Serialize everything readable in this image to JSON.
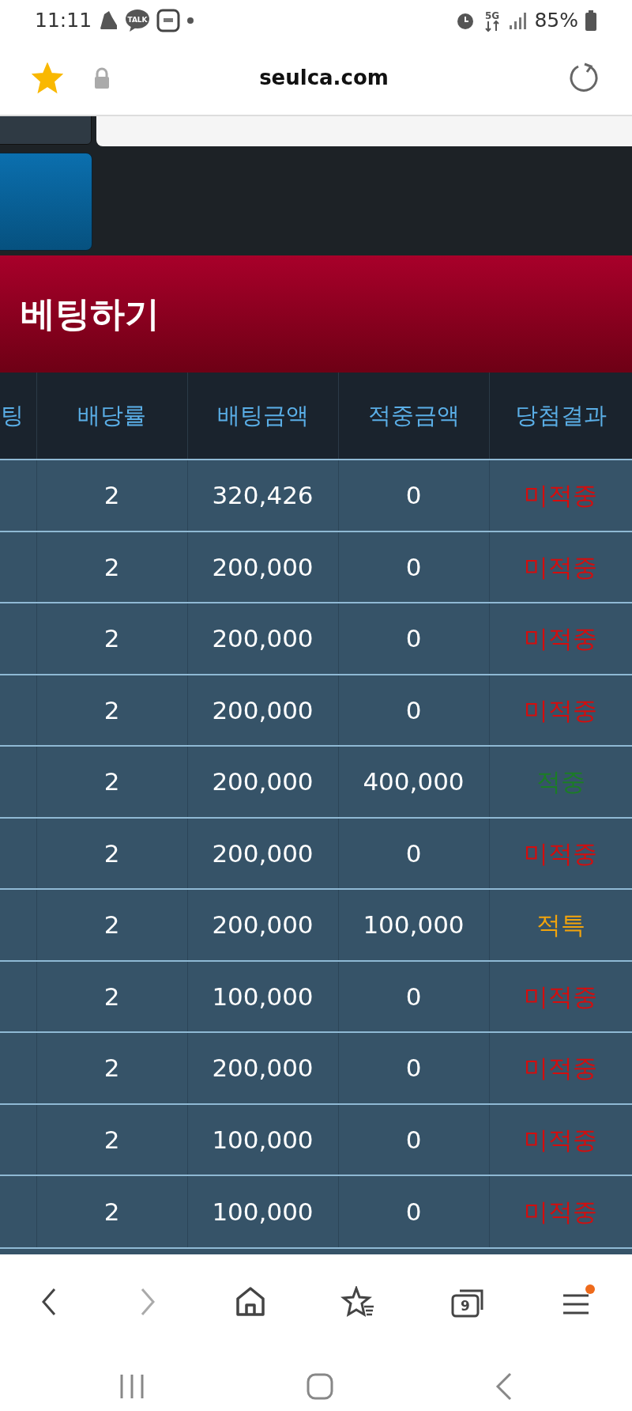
{
  "status_bar": {
    "time": "11:11",
    "chat_badge": "TALK",
    "network": "5G",
    "battery": "85%"
  },
  "address_bar": {
    "url": "seulca.com",
    "bookmarked": true
  },
  "section_title": "베팅하기",
  "table": {
    "columns": [
      "팅",
      "배당률",
      "배팅금액",
      "적중금액",
      "당첨결과"
    ],
    "rows": [
      {
        "odds": "2",
        "bet": "320,426",
        "win": "0",
        "result": "미적중",
        "kind": "miss"
      },
      {
        "odds": "2",
        "bet": "200,000",
        "win": "0",
        "result": "미적중",
        "kind": "miss"
      },
      {
        "odds": "2",
        "bet": "200,000",
        "win": "0",
        "result": "미적중",
        "kind": "miss"
      },
      {
        "odds": "2",
        "bet": "200,000",
        "win": "0",
        "result": "미적중",
        "kind": "miss"
      },
      {
        "odds": "2",
        "bet": "200,000",
        "win": "400,000",
        "result": "적중",
        "kind": "hit"
      },
      {
        "odds": "2",
        "bet": "200,000",
        "win": "0",
        "result": "미적중",
        "kind": "miss"
      },
      {
        "odds": "2",
        "bet": "200,000",
        "win": "100,000",
        "result": "적특",
        "kind": "void"
      },
      {
        "odds": "2",
        "bet": "100,000",
        "win": "0",
        "result": "미적중",
        "kind": "miss"
      },
      {
        "odds": "2",
        "bet": "200,000",
        "win": "0",
        "result": "미적중",
        "kind": "miss"
      },
      {
        "odds": "2",
        "bet": "100,000",
        "win": "0",
        "result": "미적중",
        "kind": "miss"
      },
      {
        "odds": "2",
        "bet": "100,000",
        "win": "0",
        "result": "미적중",
        "kind": "miss"
      }
    ]
  },
  "browser_toolbar": {
    "tab_count": "9",
    "menu_notification": true
  }
}
